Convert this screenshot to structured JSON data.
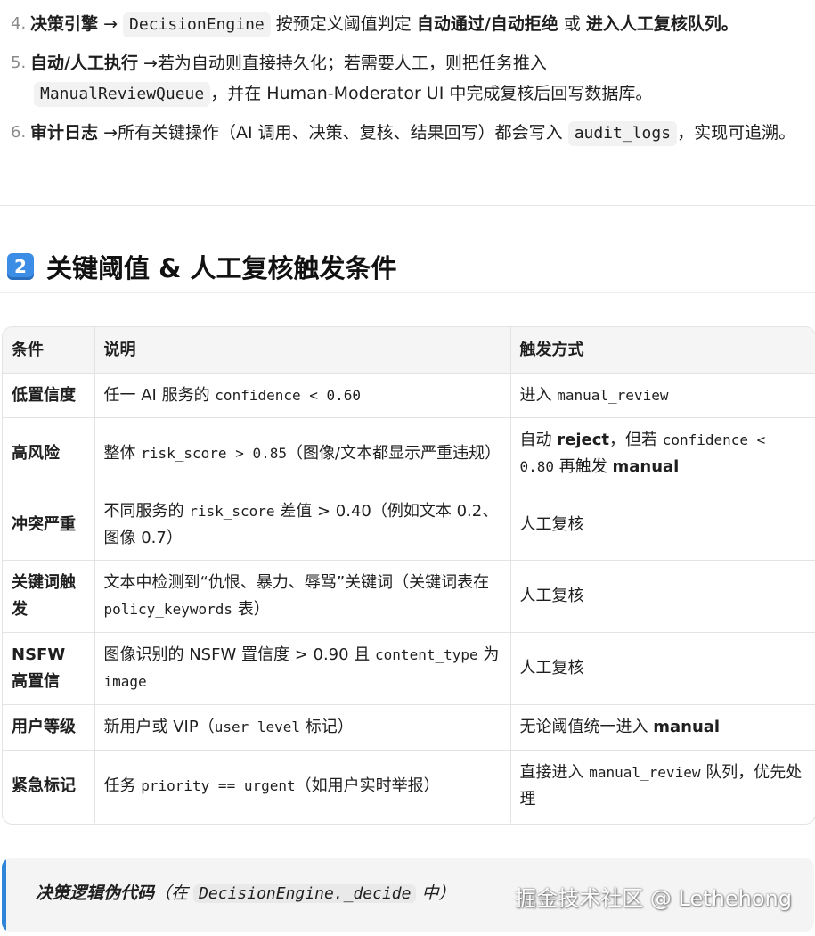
{
  "steps": [
    {
      "num": "4.",
      "title": "决策引擎",
      "arrow": "→",
      "code": "DecisionEngine",
      "text1": "按预定义阈值判定",
      "bold1": "自动通过/自动拒绝",
      "text2": "或",
      "bold2": "进入人工复核队列。"
    },
    {
      "num": "5.",
      "title": "自动/人工执行",
      "arrow": "→",
      "text1": "若为自动则直接持久化；若需要人工，则把任务推入",
      "code": "ManualReviewQueue",
      "text2": "，并在 Human-Moderator UI 中完成复核后回写数据库。"
    },
    {
      "num": "6.",
      "title": "审计日志",
      "arrow": "→",
      "text1": "所有关键操作（AI 调用、决策、复核、结果回写）都会写入",
      "code": "audit_logs",
      "text2": "，实现可追溯。"
    }
  ],
  "section": {
    "badge": "2",
    "title": "关键阈值 & 人工复核触发条件"
  },
  "table": {
    "headers": [
      "条件",
      "说明",
      "触发方式"
    ],
    "rows": [
      {
        "cond": "低置信度",
        "desc": [
          {
            "t": "text",
            "v": "任一 AI 服务的 "
          },
          {
            "t": "code",
            "v": "confidence < 0.60"
          }
        ],
        "trigger": [
          {
            "t": "text",
            "v": "进入 "
          },
          {
            "t": "code",
            "v": "manual_review"
          }
        ]
      },
      {
        "cond": "高风险",
        "desc": [
          {
            "t": "text",
            "v": "整体 "
          },
          {
            "t": "code",
            "v": "risk_score > 0.85"
          },
          {
            "t": "text",
            "v": "（图像/文本都显示严重违规）"
          }
        ],
        "trigger": [
          {
            "t": "text",
            "v": "自动 "
          },
          {
            "t": "bold",
            "v": "reject"
          },
          {
            "t": "text",
            "v": "，但若 "
          },
          {
            "t": "code",
            "v": "confidence < 0.80"
          },
          {
            "t": "text",
            "v": " 再触发 "
          },
          {
            "t": "bold",
            "v": "manual"
          }
        ]
      },
      {
        "cond": "冲突严重",
        "desc": [
          {
            "t": "text",
            "v": "不同服务的 "
          },
          {
            "t": "code",
            "v": "risk_score"
          },
          {
            "t": "text",
            "v": " 差值 > 0.40（例如文本 0.2、图像 0.7）"
          }
        ],
        "trigger": [
          {
            "t": "text",
            "v": "人工复核"
          }
        ]
      },
      {
        "cond": "关键词触发",
        "desc": [
          {
            "t": "text",
            "v": "文本中检测到“仇恨、暴力、辱骂”关键词（关键词表在 "
          },
          {
            "t": "code",
            "v": "policy_keywords"
          },
          {
            "t": "text",
            "v": " 表）"
          }
        ],
        "trigger": [
          {
            "t": "text",
            "v": "人工复核"
          }
        ]
      },
      {
        "cond": "NSFW 高置信",
        "desc": [
          {
            "t": "text",
            "v": "图像识别的 NSFW 置信度 > 0.90 且 "
          },
          {
            "t": "code",
            "v": "content_type"
          },
          {
            "t": "text",
            "v": " 为 "
          },
          {
            "t": "code",
            "v": "image"
          }
        ],
        "trigger": [
          {
            "t": "text",
            "v": "人工复核"
          }
        ]
      },
      {
        "cond": "用户等级",
        "desc": [
          {
            "t": "text",
            "v": "新用户或 VIP（"
          },
          {
            "t": "code",
            "v": "user_level"
          },
          {
            "t": "text",
            "v": " 标记）"
          }
        ],
        "trigger": [
          {
            "t": "text",
            "v": "无论阈值统一进入 "
          },
          {
            "t": "bold",
            "v": "manual"
          }
        ]
      },
      {
        "cond": "紧急标记",
        "desc": [
          {
            "t": "text",
            "v": "任务 "
          },
          {
            "t": "code",
            "v": "priority == urgent"
          },
          {
            "t": "text",
            "v": "（如用户实时举报）"
          }
        ],
        "trigger": [
          {
            "t": "text",
            "v": "直接进入 "
          },
          {
            "t": "code",
            "v": "manual_review"
          },
          {
            "t": "text",
            "v": " 队列，优先处理"
          }
        ]
      }
    ]
  },
  "quote": {
    "bold": "决策逻辑伪代码",
    "text1": "（在 ",
    "code": "DecisionEngine._decide",
    "text2": " 中）"
  },
  "watermark": "掘金技术社区 @ Lethehong",
  "colors": {
    "accent": "#2f86d9",
    "keycap": "#3b8de6",
    "code_bg": "#f2f2f2"
  }
}
